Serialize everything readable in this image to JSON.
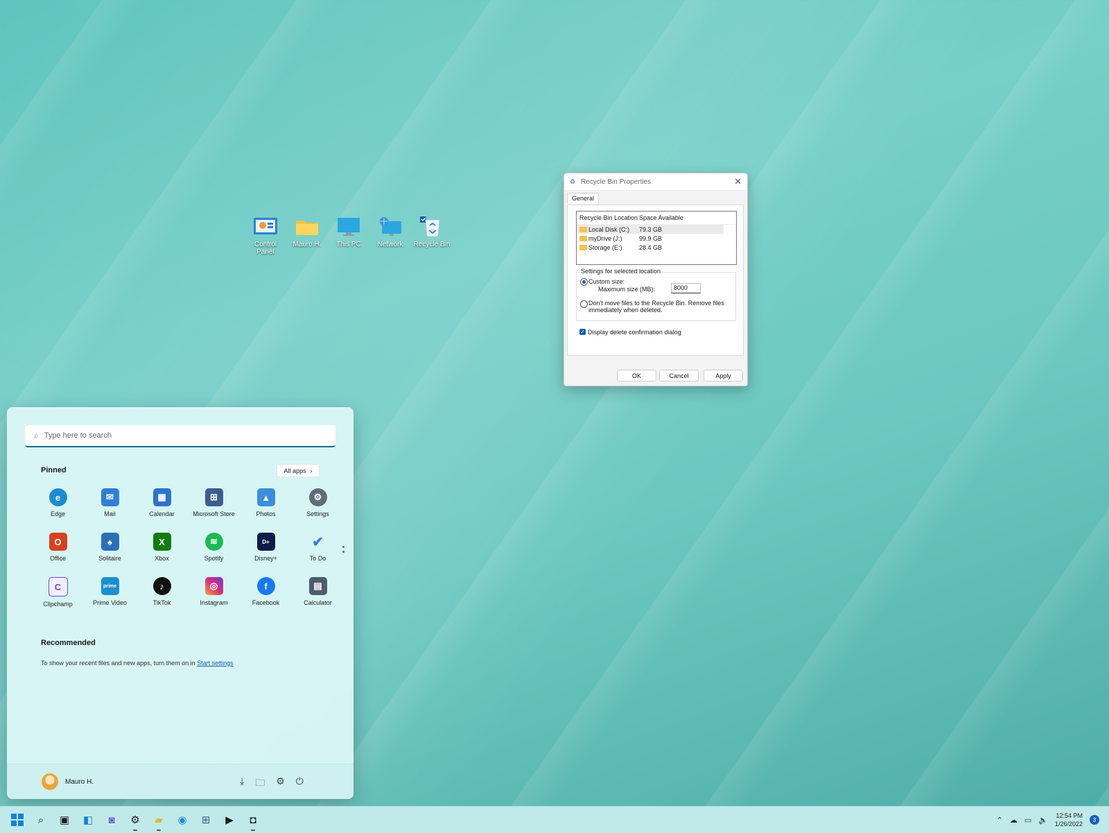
{
  "desktop": {
    "icons": [
      {
        "label": "Control Panel"
      },
      {
        "label": "Mauro H."
      },
      {
        "label": "This PC"
      },
      {
        "label": "Network"
      },
      {
        "label": "Recycle Bin"
      }
    ]
  },
  "dialog": {
    "title": "Recycle Bin Properties",
    "close": "✕",
    "tab_general": "General",
    "col_location": "Recycle Bin Location",
    "col_space": "Space Available",
    "locations": [
      {
        "name": "Local Disk (C:)",
        "space": "79.3 GB"
      },
      {
        "name": "myDrive (J:)",
        "space": "99.9 GB"
      },
      {
        "name": "Storage (E:)",
        "space": "28.4 GB"
      }
    ],
    "settings_title": "Settings for selected location",
    "custom_size": "Custom size:",
    "max_size_label": "Maximum size (MB):",
    "max_size_value": "8000",
    "dont_move_line1": "Don't move files to the Recycle Bin. Remove files",
    "dont_move_line2": "immediately when deleted.",
    "display_confirm": "Display delete confirmation dialog",
    "ok": "OK",
    "cancel": "Cancel",
    "apply": "Apply"
  },
  "start": {
    "search_placeholder": "Type here to search",
    "pinned_title": "Pinned",
    "all_apps": "All apps",
    "apps": [
      {
        "label": "Edge",
        "color": "#1c8bd1"
      },
      {
        "label": "Mail",
        "color": "#2f7fd6"
      },
      {
        "label": "Calendar",
        "color": "#2d74c9"
      },
      {
        "label": "Microsoft Store",
        "color": "#3a5f8f"
      },
      {
        "label": "Photos",
        "color": "#3b8fd9"
      },
      {
        "label": "Settings",
        "color": "#5f6d7a"
      },
      {
        "label": "Office",
        "color": "#d8401f"
      },
      {
        "label": "Solitaire",
        "color": "#2b6fb5"
      },
      {
        "label": "Xbox",
        "color": "#107c10"
      },
      {
        "label": "Spotify",
        "color": "#1db954"
      },
      {
        "label": "Disney+",
        "color": "#0e1c4a"
      },
      {
        "label": "To Do",
        "color": "#3b7de0"
      },
      {
        "label": "Clipchamp",
        "color": "#6b4bd6"
      },
      {
        "label": "Prime Video",
        "color": "#1d8fd0"
      },
      {
        "label": "TikTok",
        "color": "#111111"
      },
      {
        "label": "Instagram",
        "color": "#d6307a"
      },
      {
        "label": "Facebook",
        "color": "#1877f2"
      },
      {
        "label": "Calculator",
        "color": "#4e5d6b"
      }
    ],
    "recommended_title": "Recommended",
    "recommended_text": "To show your recent files and new apps, turn them on in",
    "start_settings_link": "Start settings",
    "user_name": "Mauro H."
  },
  "taskbar": {
    "time": "12:54 PM",
    "date": "1/26/2022",
    "notifications": "3"
  }
}
